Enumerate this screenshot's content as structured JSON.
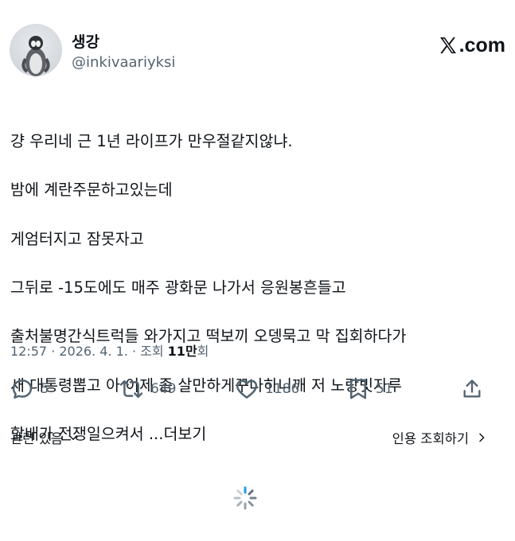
{
  "author": {
    "name": "생강",
    "handle": "@inkivaariyksi"
  },
  "brand": {
    "logo_text": ".com"
  },
  "post": {
    "lines": [
      "걍 우리네 근 1년 라이프가 만우절같지않냐.",
      "밤에 계란주문하고있는데",
      "게엄터지고 잠못자고",
      "그뒤로 -15도에도 매주 광화문 나가서 응원봉흔들고",
      "출처불명간식트럭들 와가지고 떡보끼 오뎅묵고 막 집회하다가",
      "새 대통령뽑고 아 이제 좀 살만하게꾸나하니깨 저 노랑빗자루",
      "할배가 전쟁일으켜서 "
    ],
    "more_label": "...더보기"
  },
  "meta": {
    "time_date": "12:57 · 2026. 4. 1. · 조회 ",
    "views": "11만",
    "views_suffix": "회"
  },
  "actions": {
    "replies": "5",
    "reposts": "649",
    "likes": "1186",
    "bookmarks": "51"
  },
  "footer": {
    "related_label": "관련 있음",
    "quotes_label": "인용 조회하기"
  },
  "colors": {
    "text": "#0f1419",
    "secondary": "#536471"
  },
  "icons": [
    "reply-icon",
    "repost-icon",
    "like-icon",
    "bookmark-icon",
    "share-icon",
    "chevron-down-icon",
    "chevron-right-icon",
    "loading-spinner-icon",
    "x-logo-icon"
  ]
}
